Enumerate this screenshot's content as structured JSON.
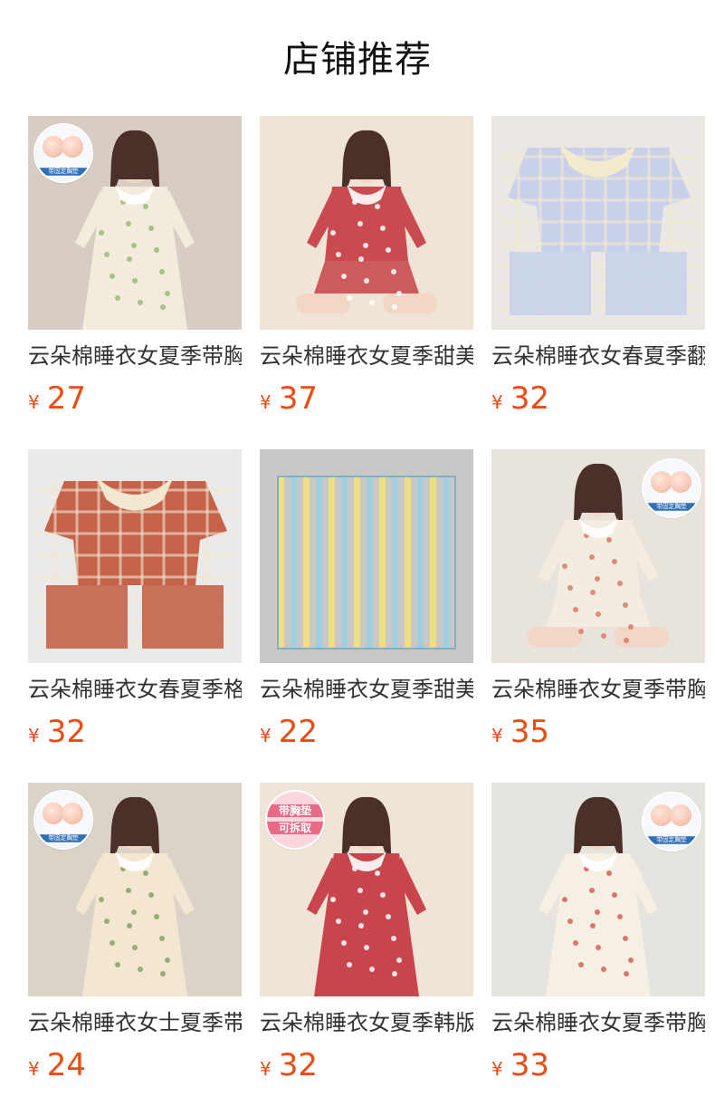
{
  "header": {
    "title": "店铺推荐"
  },
  "currency_symbol": "¥",
  "products": [
    {
      "name": "云朵棉睡衣女夏季带胸垫",
      "price": "27",
      "badge": "cups",
      "badge_position": "left",
      "badge_text": "带固定胸垫",
      "scene": "dress-cream",
      "colors": {
        "bg": "#d7cdc4",
        "main": "#f3ebdc",
        "accent": "#9ab97b",
        "skin": "#f2d6c6"
      }
    },
    {
      "name": "云朵棉睡衣女夏季甜美格子",
      "price": "37",
      "badge": "",
      "badge_position": "",
      "badge_text": "",
      "scene": "set-red-plaid",
      "colors": {
        "bg": "#f0e4d6",
        "main": "#c94b4f",
        "accent": "#ffffff",
        "skin": "#f2d6c6"
      }
    },
    {
      "name": "云朵棉睡衣女春夏季翻领",
      "price": "32",
      "badge": "",
      "badge_position": "",
      "badge_text": "",
      "scene": "flat-blue-plaid",
      "colors": {
        "bg": "#ebe7e2",
        "main": "#c9d1ea",
        "accent": "#f4ebcf",
        "skin": "#e7d3b6"
      }
    },
    {
      "name": "云朵棉睡衣女春夏季格子",
      "price": "32",
      "badge": "",
      "badge_position": "",
      "badge_text": "",
      "scene": "flat-red-plaid",
      "colors": {
        "bg": "#eceae8",
        "main": "#c4634a",
        "accent": "#f2e7cf",
        "skin": "#e7d3b6"
      }
    },
    {
      "name": "云朵棉睡衣女夏季甜美条纹",
      "price": "22",
      "badge": "",
      "badge_position": "",
      "badge_text": "",
      "scene": "flat-stripe",
      "colors": {
        "bg": "#c9c8c6",
        "main": "#9fd0e2",
        "accent": "#f1e07f",
        "skin": "#e9a44e"
      }
    },
    {
      "name": "云朵棉睡衣女夏季带胸垫",
      "price": "35",
      "badge": "cups",
      "badge_position": "right",
      "badge_text": "带固定胸垫",
      "scene": "set-cream-shorts",
      "colors": {
        "bg": "#e8e4dc",
        "main": "#f4ece0",
        "accent": "#d9796b",
        "skin": "#f2d6c6"
      }
    },
    {
      "name": "云朵棉睡衣女士夏季带胸垫",
      "price": "24",
      "badge": "cups",
      "badge_position": "left",
      "badge_text": "带固定胸垫",
      "scene": "dress-floral",
      "colors": {
        "bg": "#dcd3c8",
        "main": "#f3e7d2",
        "accent": "#8aa068",
        "skin": "#f2d6c6"
      }
    },
    {
      "name": "云朵棉睡衣女夏季韩版格子",
      "price": "32",
      "badge": "pink",
      "badge_position": "left",
      "badge_text": "",
      "badge_lines": [
        "带胸垫",
        "可拆取"
      ],
      "scene": "dress-red-plaid",
      "colors": {
        "bg": "#f0e4d6",
        "main": "#c8454d",
        "accent": "#ffffff",
        "skin": "#f2d6c6"
      }
    },
    {
      "name": "云朵棉睡衣女夏季带胸垫",
      "price": "33",
      "badge": "cups",
      "badge_position": "right",
      "badge_text": "带固定胸垫",
      "scene": "dress-strawberry",
      "colors": {
        "bg": "#e5e4df",
        "main": "#f6efe4",
        "accent": "#d6605a",
        "skin": "#f2d6c6"
      }
    }
  ]
}
